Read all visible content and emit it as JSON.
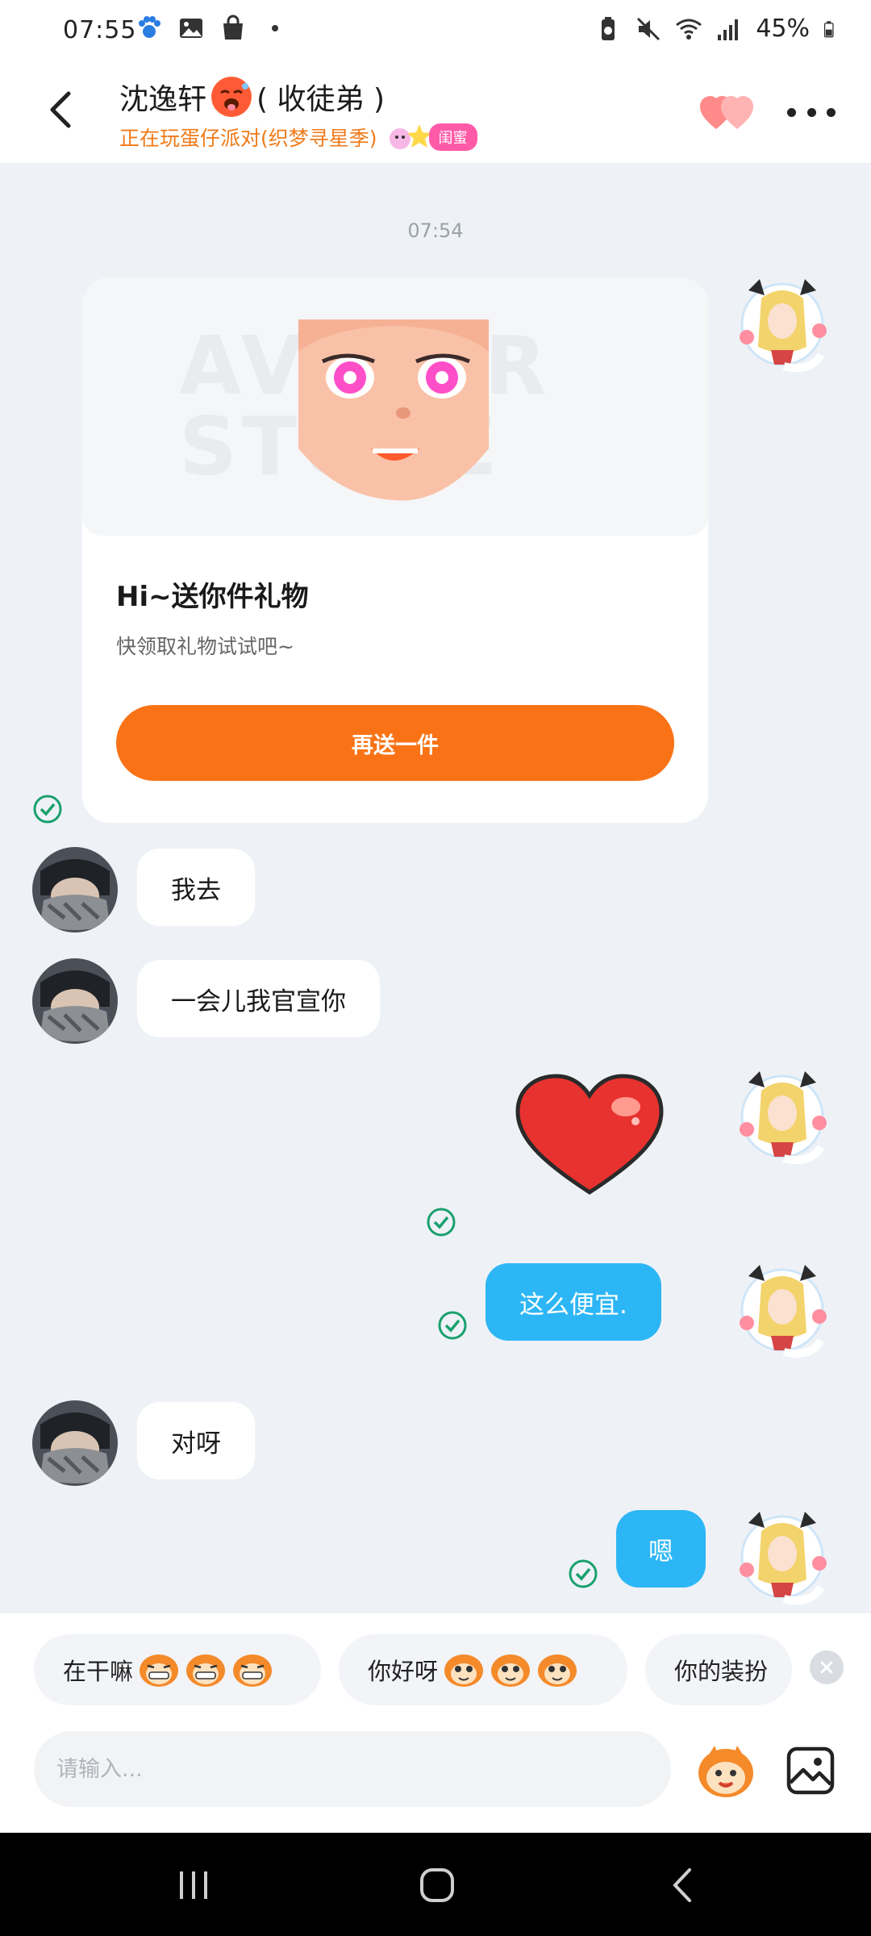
{
  "status_bar": {
    "time": "07:55",
    "battery": "45%",
    "icons": [
      "paw-icon",
      "gallery-icon",
      "shopping-bag-icon",
      "dot-icon",
      "battery-saver-icon",
      "mute-icon",
      "wifi-icon",
      "signal-icon",
      "battery-icon"
    ]
  },
  "header": {
    "title": "沈逸轩",
    "title_suffix": "( 收徒弟 )",
    "subtitle": "正在玩蛋仔派对(织梦寻星季)",
    "badge": "闺蜜",
    "icons": [
      "back-icon",
      "hearts-icon",
      "more-icon"
    ]
  },
  "chat": {
    "timestamp": "07:54",
    "gift_card": {
      "watermark": "AVATAR STORE",
      "title": "Hi~送你件礼物",
      "subtitle": "快领取礼物试试吧~",
      "button": "再送一件"
    },
    "messages": [
      {
        "from": "other",
        "text": "我去"
      },
      {
        "from": "other",
        "text": "一会儿我官宣你"
      },
      {
        "from": "self",
        "sticker": "heart-sticker"
      },
      {
        "from": "self",
        "text": "这么便宜."
      },
      {
        "from": "other",
        "text": "对呀"
      },
      {
        "from": "self",
        "text": "嗯"
      }
    ]
  },
  "quick_replies": [
    {
      "text": "在干嘛",
      "emoji": "grin-monkey-icon"
    },
    {
      "text": "你好呀",
      "emoji": "smile-monkey-icon"
    },
    {
      "text": "你的装扮",
      "emoji": ""
    }
  ],
  "input": {
    "placeholder": "请输入..."
  },
  "colors": {
    "accent_orange": "#f97316",
    "bubble_blue": "#2db6f5",
    "check_green": "#1aa06d",
    "subtitle_orange": "#f07a18"
  }
}
